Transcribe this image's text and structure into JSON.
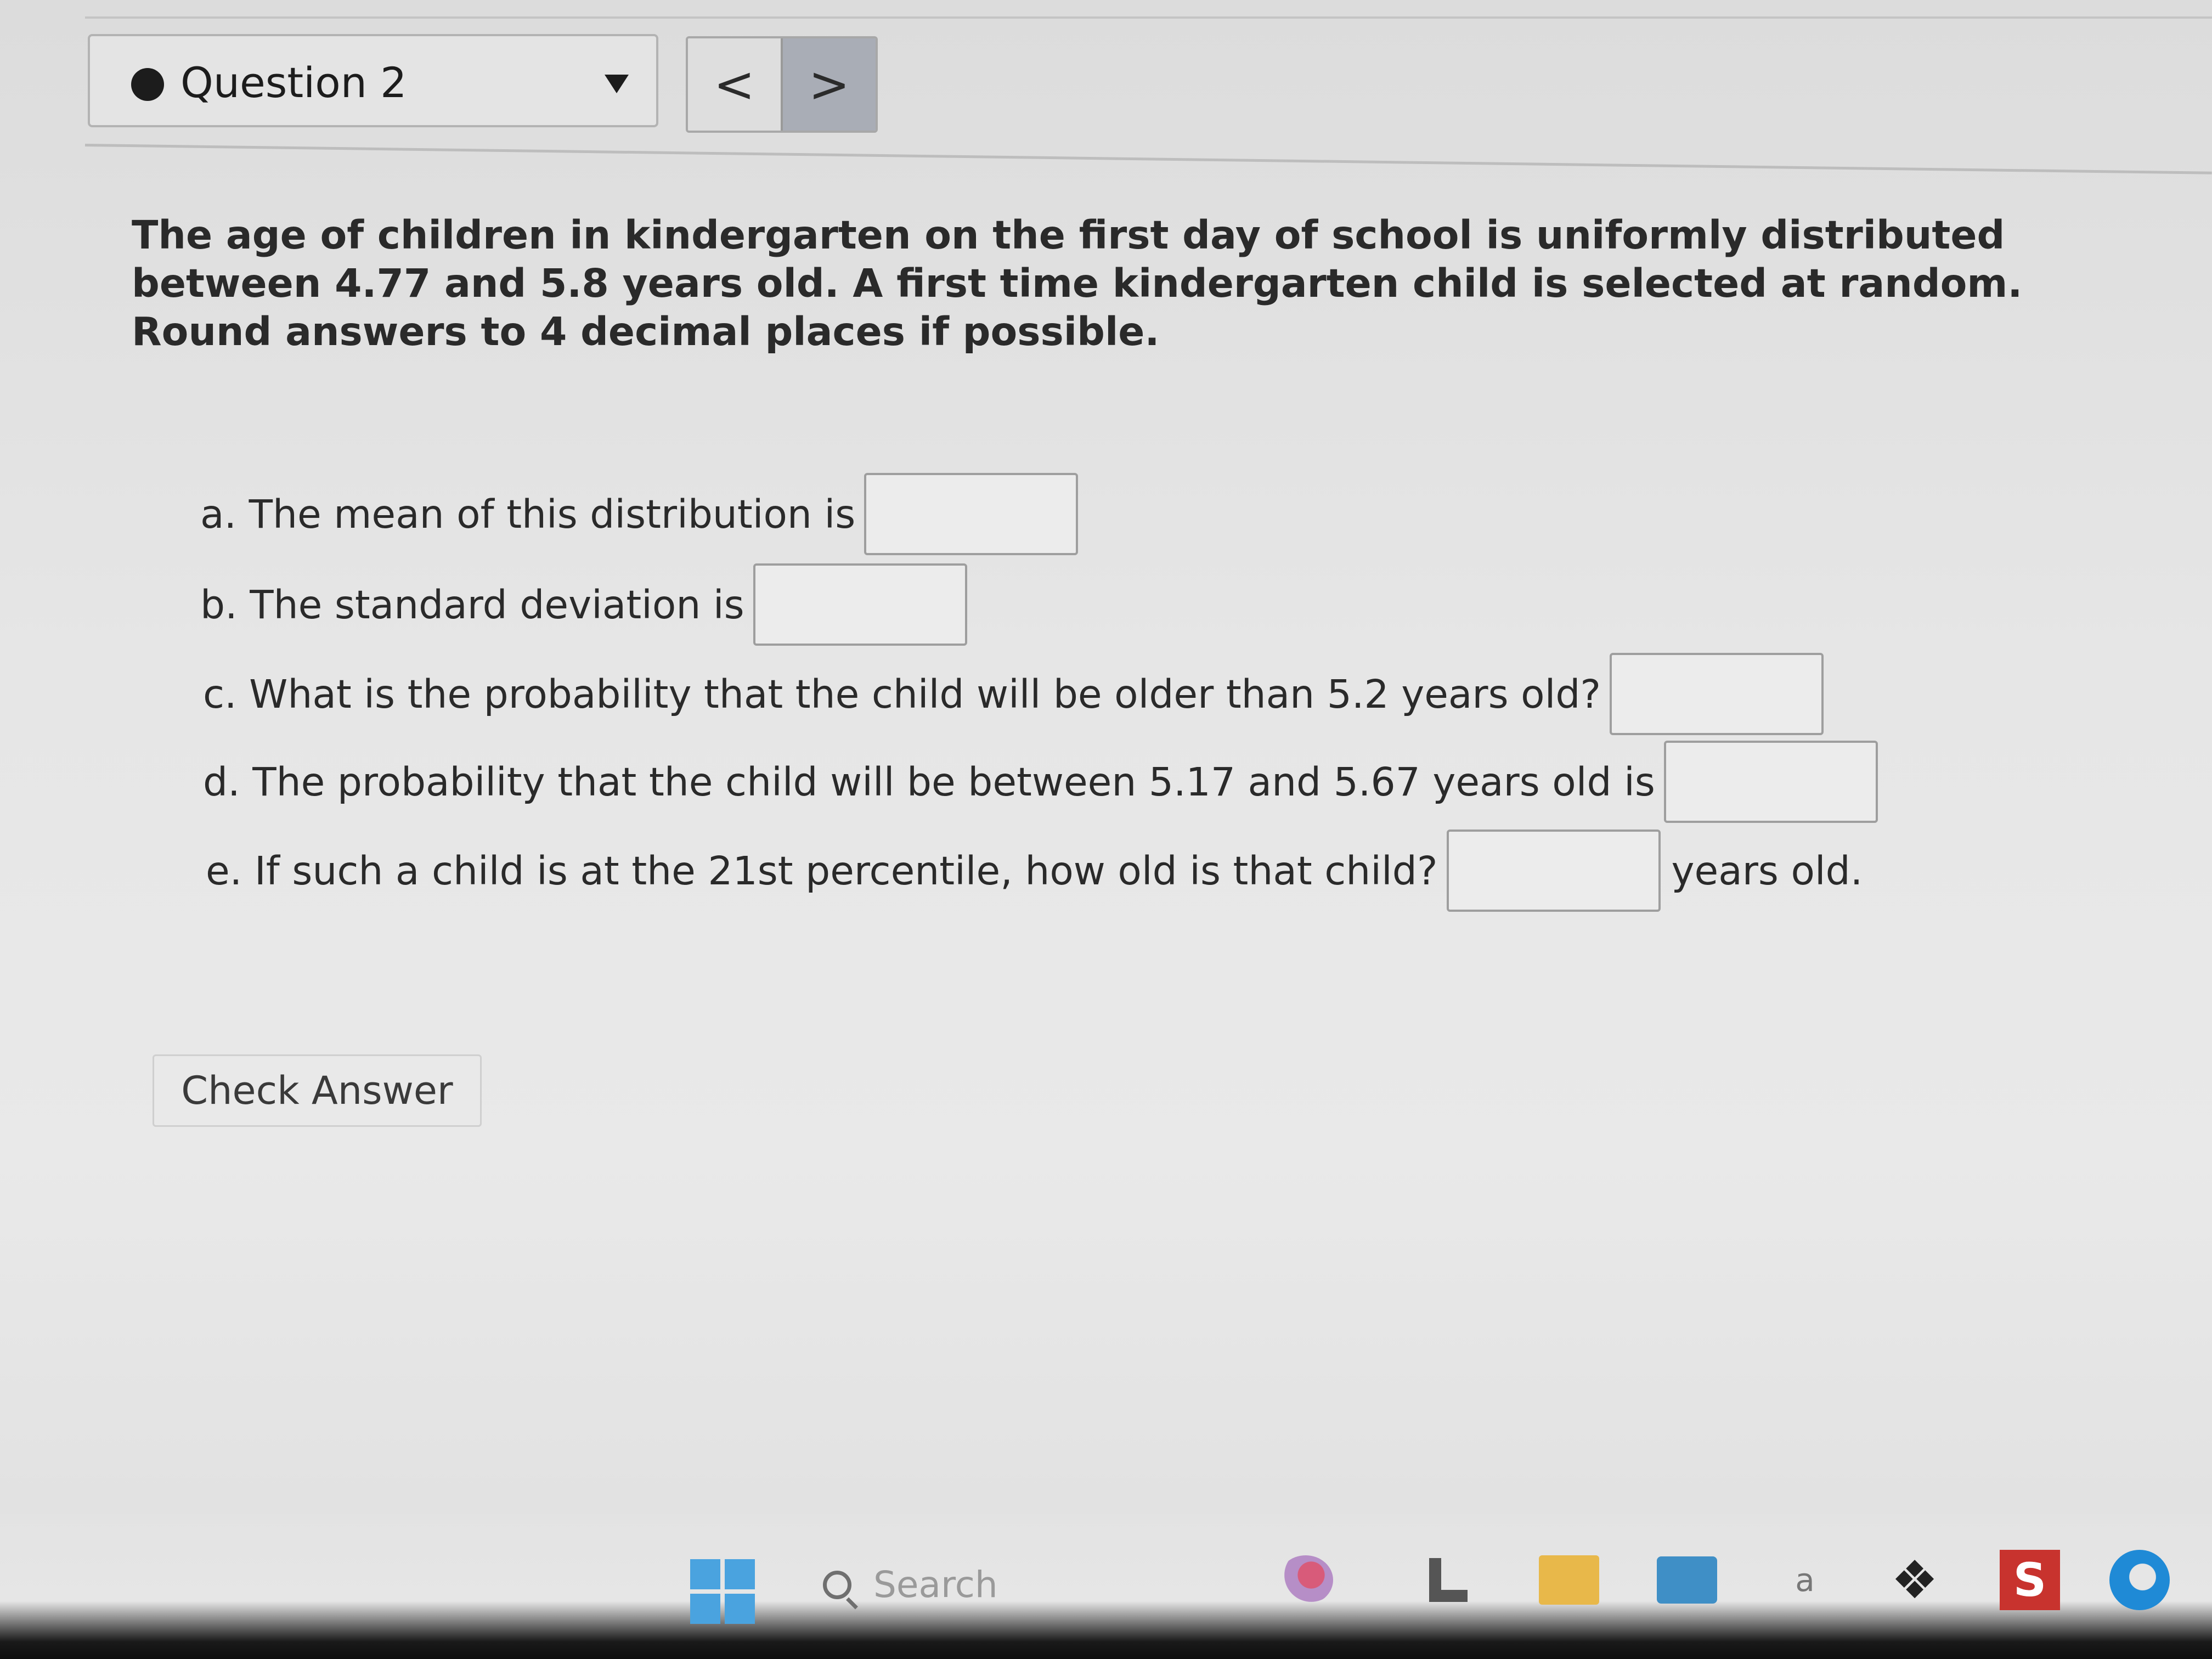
{
  "header": {
    "question_label": "Question 2",
    "prev_glyph": "<",
    "next_glyph": ">"
  },
  "problem": {
    "prompt": "The age of children in kindergarten on the first day of school is uniformly distributed between 4.77 and 5.8 years old. A first time kindergarten child is selected at random. Round answers to 4 decimal places if possible.",
    "parts": [
      {
        "text": "a. The mean of this distribution is",
        "value": "",
        "suffix": ""
      },
      {
        "text": "b. The standard deviation is",
        "value": "",
        "suffix": ""
      },
      {
        "text": "c. What is the probability that the child will be older than 5.2 years old?",
        "value": "",
        "suffix": ""
      },
      {
        "text": "d. The probability that the child will be between 5.17 and 5.67 years old is",
        "value": "",
        "suffix": ""
      },
      {
        "text": "e. If such a child is at the 21st percentile, how old is that child?",
        "value": "",
        "suffix": "years old."
      }
    ]
  },
  "actions": {
    "check_answer": "Check Answer"
  },
  "taskbar": {
    "search_placeholder": "Search",
    "icons": [
      "windows-start-icon",
      "search-icon",
      "flower-app-icon",
      "l-app-icon",
      "folder-icon",
      "mail-icon",
      "a-app-icon",
      "dropbox-icon",
      "s-app-icon",
      "edge-icon"
    ],
    "a_glyph": "a",
    "dropbox_glyph": "❖",
    "s_glyph": "S"
  }
}
